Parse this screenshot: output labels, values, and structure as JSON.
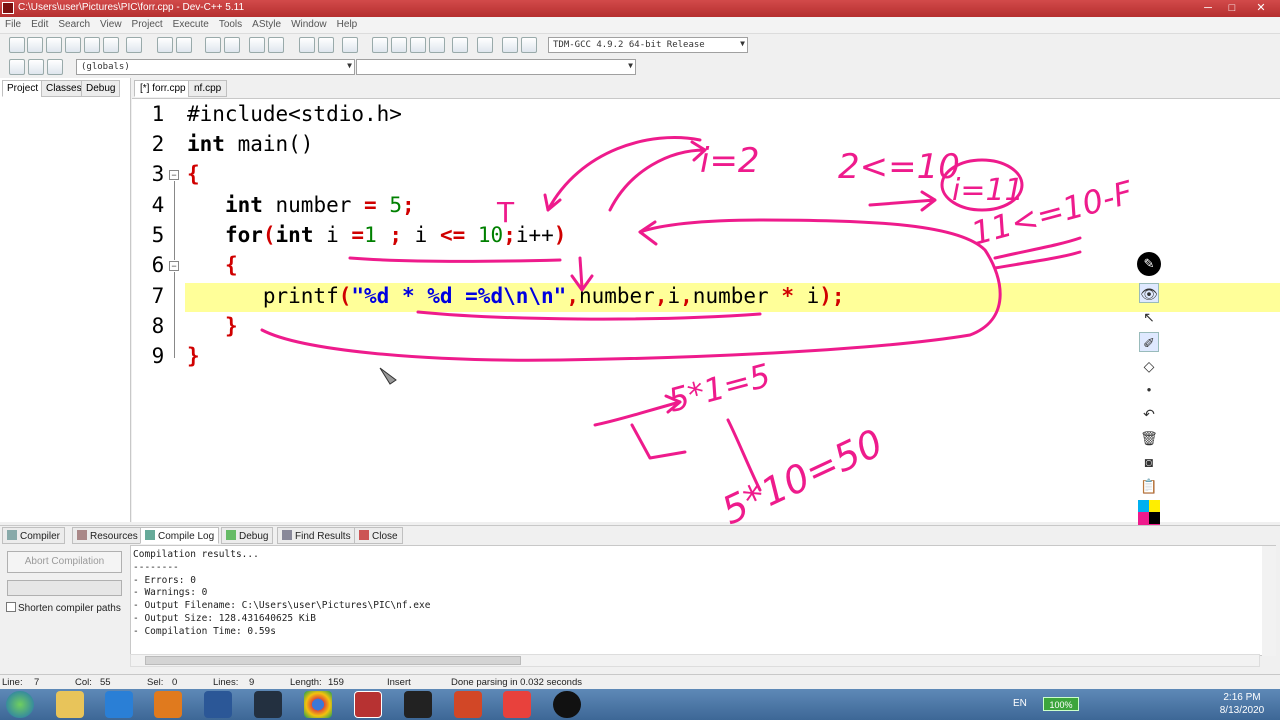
{
  "window": {
    "title": "C:\\Users\\user\\Pictures\\PIC\\forr.cpp - Dev-C++ 5.11",
    "controls": [
      "─",
      "□",
      "✕"
    ]
  },
  "menu": [
    "File",
    "Edit",
    "Search",
    "View",
    "Project",
    "Execute",
    "Tools",
    "AStyle",
    "Window",
    "Help"
  ],
  "toolbar": {
    "compiler_select": "TDM-GCC 4.9.2 64-bit Release",
    "scope_select": "(globals)",
    "function_select": ""
  },
  "left_tabs": [
    "Project",
    "Classes",
    "Debug"
  ],
  "editor_tabs": [
    "[*] forr.cpp",
    "nf.cpp"
  ],
  "line_numbers": [
    "1",
    "2",
    "3",
    "4",
    "5",
    "6",
    "7",
    "8",
    "9"
  ],
  "code": {
    "l1": "#include<stdio.h>",
    "l2_kw": "int",
    "l2_rest": " main()",
    "l3": "{",
    "l4_kw": "int",
    "l4_mid": " number ",
    "l4_eq": "=",
    "l4_sp": " ",
    "l4_num": "5",
    "l4_semi": ";",
    "l5_for": "for",
    "l5_p1": "(",
    "l5_int": "int",
    "l5_i": " i ",
    "l5_eq": "=",
    "l5_one": "1",
    "l5_s1": " ; ",
    "l5_i2": "i",
    "l5_le": " <= ",
    "l5_ten": "10",
    "l5_s2": ";",
    "l5_inc": "i++",
    "l5_p2": ")",
    "l6": "{",
    "l7_fn": "printf",
    "l7_p1": "(",
    "l7_str": "\"%d * %d =%d\\n\\n\"",
    "l7_c1": ",",
    "l7_v1": "number",
    "l7_c2": ",",
    "l7_v2": "i",
    "l7_c3": ",",
    "l7_v3": "number ",
    "l7_op": "*",
    "l7_v4": " i",
    "l7_end": ");",
    "l8": "}",
    "l9": "}"
  },
  "annotations": {
    "i2": "i=2",
    "cond1": "2<=10",
    "i11": "i=11",
    "cond2": "11<=10-F",
    "t": "T",
    "calc1": "5*1=5",
    "calc2": "5*10=50"
  },
  "annotation_tools": [
    "pen-tool",
    "eye-icon",
    "select-arrow",
    "highlighter",
    "eraser",
    "dot",
    "undo",
    "trash",
    "camera",
    "clipboard",
    "palette"
  ],
  "bottom_tabs": [
    "Compiler",
    "Resources",
    "Compile Log",
    "Debug",
    "Find Results",
    "Close"
  ],
  "compile_panel": {
    "abort_label": "Abort Compilation",
    "shorten_label": "Shorten compiler paths",
    "log": [
      "Compilation results...",
      "--------",
      "- Errors: 0",
      "- Warnings: 0",
      "- Output Filename: C:\\Users\\user\\Pictures\\PIC\\nf.exe",
      "- Output Size: 128.431640625 KiB",
      "- Compilation Time: 0.59s"
    ]
  },
  "status": {
    "line_label": "Line:",
    "line_val": "7",
    "col_label": "Col:",
    "col_val": "55",
    "sel_label": "Sel:",
    "sel_val": "0",
    "lines_label": "Lines:",
    "lines_val": "9",
    "length_label": "Length:",
    "length_val": "159",
    "mode": "Insert",
    "message": "Done parsing in 0.032 seconds"
  },
  "taskbar": {
    "lang": "EN",
    "battery": "100%",
    "time": "2:16 PM",
    "date": "8/13/2020"
  }
}
